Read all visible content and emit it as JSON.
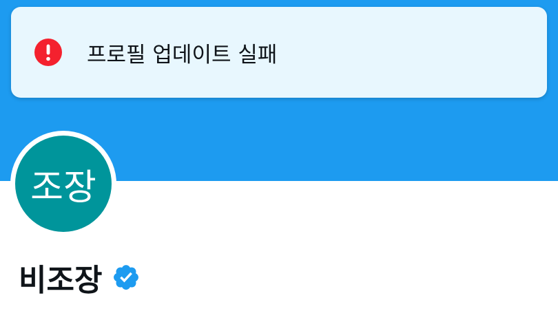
{
  "toast": {
    "message": "프로필 업데이트 실패",
    "icon": "error-icon"
  },
  "profile": {
    "avatar_initials": "조장",
    "display_name": "비조장",
    "verified_icon": "verified-badge-icon"
  },
  "colors": {
    "banner": "#1d9bf0",
    "toast_background": "#e8f7fe",
    "error": "#f4212e",
    "avatar": "#00959b",
    "verified": "#1d9bf0",
    "text": "#0f1419"
  }
}
